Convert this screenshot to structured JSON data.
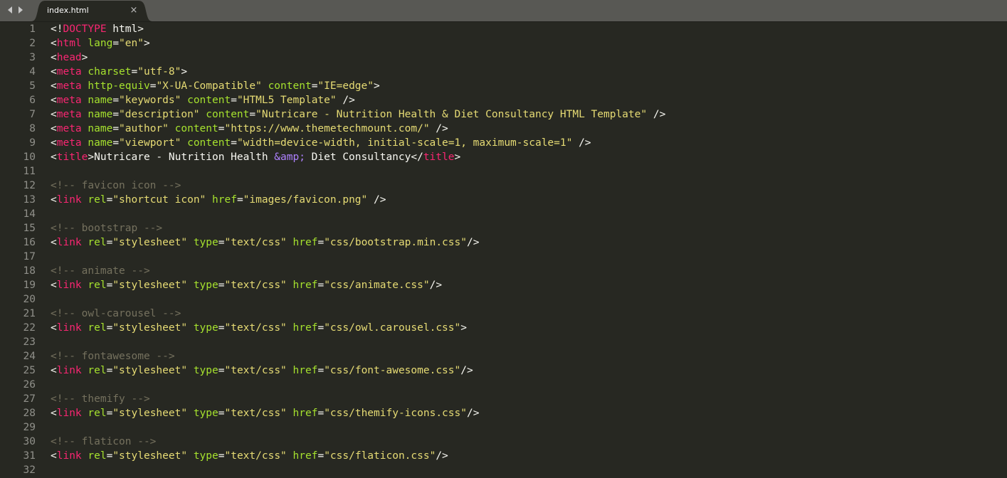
{
  "tab": {
    "filename": "index.html",
    "close_glyph": "×"
  },
  "nav": {
    "back_icon": "chevron-left-icon",
    "forward_icon": "chevron-right-icon"
  },
  "theme": {
    "background": "#272822",
    "tabbar": "#585854",
    "tag": "#f92672",
    "attribute": "#a6e22e",
    "string": "#e6db74",
    "comment": "#75715e",
    "entity": "#ae81ff",
    "text": "#f8f8f2",
    "line_number": "#90908a"
  },
  "code_lines": [
    {
      "n": "1",
      "tokens": [
        [
          "p",
          "<!"
        ],
        [
          "tag",
          "DOCTYPE"
        ],
        [
          "p",
          " html>"
        ]
      ]
    },
    {
      "n": "2",
      "tokens": [
        [
          "p",
          "<"
        ],
        [
          "tag",
          "html"
        ],
        [
          "p",
          " "
        ],
        [
          "attr",
          "lang"
        ],
        [
          "p",
          "="
        ],
        [
          "str",
          "\"en\""
        ],
        [
          "p",
          ">"
        ]
      ]
    },
    {
      "n": "3",
      "tokens": [
        [
          "p",
          "<"
        ],
        [
          "tag",
          "head"
        ],
        [
          "p",
          ">"
        ]
      ]
    },
    {
      "n": "4",
      "tokens": [
        [
          "p",
          "<"
        ],
        [
          "tag",
          "meta"
        ],
        [
          "p",
          " "
        ],
        [
          "attr",
          "charset"
        ],
        [
          "p",
          "="
        ],
        [
          "str",
          "\"utf-8\""
        ],
        [
          "p",
          ">"
        ]
      ]
    },
    {
      "n": "5",
      "tokens": [
        [
          "p",
          "<"
        ],
        [
          "tag",
          "meta"
        ],
        [
          "p",
          " "
        ],
        [
          "attr",
          "http-equiv"
        ],
        [
          "p",
          "="
        ],
        [
          "str",
          "\"X-UA-Compatible\""
        ],
        [
          "p",
          " "
        ],
        [
          "attr",
          "content"
        ],
        [
          "p",
          "="
        ],
        [
          "str",
          "\"IE=edge\""
        ],
        [
          "p",
          ">"
        ]
      ]
    },
    {
      "n": "6",
      "tokens": [
        [
          "p",
          "<"
        ],
        [
          "tag",
          "meta"
        ],
        [
          "p",
          " "
        ],
        [
          "attr",
          "name"
        ],
        [
          "p",
          "="
        ],
        [
          "str",
          "\"keywords\""
        ],
        [
          "p",
          " "
        ],
        [
          "attr",
          "content"
        ],
        [
          "p",
          "="
        ],
        [
          "str",
          "\"HTML5 Template\""
        ],
        [
          "p",
          " />"
        ]
      ]
    },
    {
      "n": "7",
      "tokens": [
        [
          "p",
          "<"
        ],
        [
          "tag",
          "meta"
        ],
        [
          "p",
          " "
        ],
        [
          "attr",
          "name"
        ],
        [
          "p",
          "="
        ],
        [
          "str",
          "\"description\""
        ],
        [
          "p",
          " "
        ],
        [
          "attr",
          "content"
        ],
        [
          "p",
          "="
        ],
        [
          "str",
          "\"Nutricare - Nutrition Health & Diet Consultancy HTML Template\""
        ],
        [
          "p",
          " />"
        ]
      ]
    },
    {
      "n": "8",
      "tokens": [
        [
          "p",
          "<"
        ],
        [
          "tag",
          "meta"
        ],
        [
          "p",
          " "
        ],
        [
          "attr",
          "name"
        ],
        [
          "p",
          "="
        ],
        [
          "str",
          "\"author\""
        ],
        [
          "p",
          " "
        ],
        [
          "attr",
          "content"
        ],
        [
          "p",
          "="
        ],
        [
          "str",
          "\"https://www.themetechmount.com/\""
        ],
        [
          "p",
          " />"
        ]
      ]
    },
    {
      "n": "9",
      "tokens": [
        [
          "p",
          "<"
        ],
        [
          "tag",
          "meta"
        ],
        [
          "p",
          " "
        ],
        [
          "attr",
          "name"
        ],
        [
          "p",
          "="
        ],
        [
          "str",
          "\"viewport\""
        ],
        [
          "p",
          " "
        ],
        [
          "attr",
          "content"
        ],
        [
          "p",
          "="
        ],
        [
          "str",
          "\"width=device-width, initial-scale=1, maximum-scale=1\""
        ],
        [
          "p",
          " />"
        ]
      ]
    },
    {
      "n": "10",
      "tokens": [
        [
          "p",
          "<"
        ],
        [
          "tag",
          "title"
        ],
        [
          "p",
          ">"
        ],
        [
          "txt",
          "Nutricare - Nutrition Health "
        ],
        [
          "ent",
          "&amp;"
        ],
        [
          "txt",
          " Diet Consultancy"
        ],
        [
          "p",
          "</"
        ],
        [
          "tag",
          "title"
        ],
        [
          "p",
          ">"
        ]
      ]
    },
    {
      "n": "11",
      "tokens": []
    },
    {
      "n": "12",
      "tokens": [
        [
          "cmt",
          "<!-- favicon icon -->"
        ]
      ]
    },
    {
      "n": "13",
      "tokens": [
        [
          "p",
          "<"
        ],
        [
          "tag",
          "link"
        ],
        [
          "p",
          " "
        ],
        [
          "attr",
          "rel"
        ],
        [
          "p",
          "="
        ],
        [
          "str",
          "\"shortcut icon\""
        ],
        [
          "p",
          " "
        ],
        [
          "attr",
          "href"
        ],
        [
          "p",
          "="
        ],
        [
          "str",
          "\"images/favicon.png\""
        ],
        [
          "p",
          " />"
        ]
      ]
    },
    {
      "n": "14",
      "tokens": []
    },
    {
      "n": "15",
      "tokens": [
        [
          "cmt",
          "<!-- bootstrap -->"
        ]
      ]
    },
    {
      "n": "16",
      "tokens": [
        [
          "p",
          "<"
        ],
        [
          "tag",
          "link"
        ],
        [
          "p",
          " "
        ],
        [
          "attr",
          "rel"
        ],
        [
          "p",
          "="
        ],
        [
          "str",
          "\"stylesheet\""
        ],
        [
          "p",
          " "
        ],
        [
          "attr",
          "type"
        ],
        [
          "p",
          "="
        ],
        [
          "str",
          "\"text/css\""
        ],
        [
          "p",
          " "
        ],
        [
          "attr",
          "href"
        ],
        [
          "p",
          "="
        ],
        [
          "str",
          "\"css/bootstrap.min.css\""
        ],
        [
          "p",
          "/>"
        ]
      ]
    },
    {
      "n": "17",
      "tokens": []
    },
    {
      "n": "18",
      "tokens": [
        [
          "cmt",
          "<!-- animate -->"
        ]
      ]
    },
    {
      "n": "19",
      "tokens": [
        [
          "p",
          "<"
        ],
        [
          "tag",
          "link"
        ],
        [
          "p",
          " "
        ],
        [
          "attr",
          "rel"
        ],
        [
          "p",
          "="
        ],
        [
          "str",
          "\"stylesheet\""
        ],
        [
          "p",
          " "
        ],
        [
          "attr",
          "type"
        ],
        [
          "p",
          "="
        ],
        [
          "str",
          "\"text/css\""
        ],
        [
          "p",
          " "
        ],
        [
          "attr",
          "href"
        ],
        [
          "p",
          "="
        ],
        [
          "str",
          "\"css/animate.css\""
        ],
        [
          "p",
          "/>"
        ]
      ]
    },
    {
      "n": "20",
      "tokens": []
    },
    {
      "n": "21",
      "tokens": [
        [
          "cmt",
          "<!-- owl-carousel -->"
        ]
      ]
    },
    {
      "n": "22",
      "tokens": [
        [
          "p",
          "<"
        ],
        [
          "tag",
          "link"
        ],
        [
          "p",
          " "
        ],
        [
          "attr",
          "rel"
        ],
        [
          "p",
          "="
        ],
        [
          "str",
          "\"stylesheet\""
        ],
        [
          "p",
          " "
        ],
        [
          "attr",
          "type"
        ],
        [
          "p",
          "="
        ],
        [
          "str",
          "\"text/css\""
        ],
        [
          "p",
          " "
        ],
        [
          "attr",
          "href"
        ],
        [
          "p",
          "="
        ],
        [
          "str",
          "\"css/owl.carousel.css\""
        ],
        [
          "p",
          ">"
        ]
      ]
    },
    {
      "n": "23",
      "tokens": []
    },
    {
      "n": "24",
      "tokens": [
        [
          "cmt",
          "<!-- fontawesome -->"
        ]
      ]
    },
    {
      "n": "25",
      "tokens": [
        [
          "p",
          "<"
        ],
        [
          "tag",
          "link"
        ],
        [
          "p",
          " "
        ],
        [
          "attr",
          "rel"
        ],
        [
          "p",
          "="
        ],
        [
          "str",
          "\"stylesheet\""
        ],
        [
          "p",
          " "
        ],
        [
          "attr",
          "type"
        ],
        [
          "p",
          "="
        ],
        [
          "str",
          "\"text/css\""
        ],
        [
          "p",
          " "
        ],
        [
          "attr",
          "href"
        ],
        [
          "p",
          "="
        ],
        [
          "str",
          "\"css/font-awesome.css\""
        ],
        [
          "p",
          "/>"
        ]
      ]
    },
    {
      "n": "26",
      "tokens": []
    },
    {
      "n": "27",
      "tokens": [
        [
          "cmt",
          "<!-- themify -->"
        ]
      ]
    },
    {
      "n": "28",
      "tokens": [
        [
          "p",
          "<"
        ],
        [
          "tag",
          "link"
        ],
        [
          "p",
          " "
        ],
        [
          "attr",
          "rel"
        ],
        [
          "p",
          "="
        ],
        [
          "str",
          "\"stylesheet\""
        ],
        [
          "p",
          " "
        ],
        [
          "attr",
          "type"
        ],
        [
          "p",
          "="
        ],
        [
          "str",
          "\"text/css\""
        ],
        [
          "p",
          " "
        ],
        [
          "attr",
          "href"
        ],
        [
          "p",
          "="
        ],
        [
          "str",
          "\"css/themify-icons.css\""
        ],
        [
          "p",
          "/>"
        ]
      ]
    },
    {
      "n": "29",
      "tokens": []
    },
    {
      "n": "30",
      "tokens": [
        [
          "cmt",
          "<!-- flaticon -->"
        ]
      ]
    },
    {
      "n": "31",
      "tokens": [
        [
          "p",
          "<"
        ],
        [
          "tag",
          "link"
        ],
        [
          "p",
          " "
        ],
        [
          "attr",
          "rel"
        ],
        [
          "p",
          "="
        ],
        [
          "str",
          "\"stylesheet\""
        ],
        [
          "p",
          " "
        ],
        [
          "attr",
          "type"
        ],
        [
          "p",
          "="
        ],
        [
          "str",
          "\"text/css\""
        ],
        [
          "p",
          " "
        ],
        [
          "attr",
          "href"
        ],
        [
          "p",
          "="
        ],
        [
          "str",
          "\"css/flaticon.css\""
        ],
        [
          "p",
          "/>"
        ]
      ]
    },
    {
      "n": "32",
      "tokens": []
    }
  ]
}
